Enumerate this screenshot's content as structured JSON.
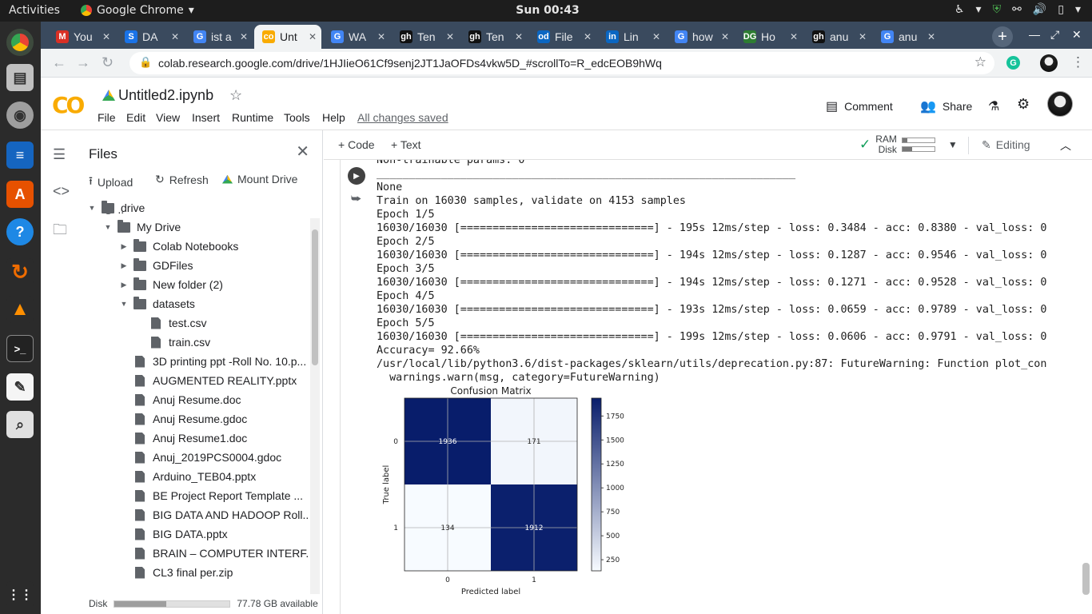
{
  "topbar": {
    "activities": "Activities",
    "app_name": "Google Chrome",
    "clock": "Sun 00:43"
  },
  "dock": {
    "icons": [
      "chrome-icon",
      "files-cabinet-icon",
      "disks-icon",
      "document-viewer-icon",
      "software-store-icon",
      "help-icon",
      "sync-icon",
      "vlc-icon",
      "terminal-icon",
      "text-editor-icon",
      "screenshot-icon",
      "app-grid-icon"
    ]
  },
  "tabs": [
    {
      "label": "You",
      "favicon": "M",
      "color": "#d93025"
    },
    {
      "label": "DA",
      "favicon": "S",
      "color": "#1a73e8"
    },
    {
      "label": "ist a",
      "favicon": "G",
      "color": "#4285f4"
    },
    {
      "label": "Unt",
      "favicon": "co",
      "color": "#f9ab00"
    },
    {
      "label": "WA",
      "favicon": "G",
      "color": "#4285f4"
    },
    {
      "label": "Ten",
      "favicon": "gh",
      "color": "#111111"
    },
    {
      "label": "Ten",
      "favicon": "gh",
      "color": "#111111"
    },
    {
      "label": "File",
      "favicon": "od",
      "color": "#0a66c2"
    },
    {
      "label": "Lin",
      "favicon": "in",
      "color": "#0a66c2"
    },
    {
      "label": "how",
      "favicon": "G",
      "color": "#4285f4"
    },
    {
      "label": "Ho",
      "favicon": "DG",
      "color": "#2e7d32"
    },
    {
      "label": "anu",
      "favicon": "gh",
      "color": "#111111"
    },
    {
      "label": "anu",
      "favicon": "G",
      "color": "#4285f4"
    }
  ],
  "address": {
    "url": "colab.research.google.com/drive/1HJIieO61Cf9senj2JT1JaOFDs4vkw5D_#scrollTo=R_edcEOB9hWq"
  },
  "colab": {
    "logo": "CO",
    "title": "Untitled2.ipynb",
    "menus": [
      "File",
      "Edit",
      "View",
      "Insert",
      "Runtime",
      "Tools",
      "Help"
    ],
    "saved_status": "All changes saved",
    "comment": "Comment",
    "share": "Share"
  },
  "files_panel": {
    "title": "Files",
    "upload": "Upload",
    "refresh": "Refresh",
    "mount": "Mount Drive",
    "up_dir": "..",
    "tree": [
      {
        "label": "drive",
        "type": "folder",
        "depth": 0,
        "caret": "▼"
      },
      {
        "label": "My Drive",
        "type": "folder",
        "depth": 1,
        "caret": "▼"
      },
      {
        "label": "Colab Notebooks",
        "type": "folder",
        "depth": 2,
        "caret": "▶"
      },
      {
        "label": "GDFiles",
        "type": "folder",
        "depth": 2,
        "caret": "▶"
      },
      {
        "label": "New folder (2)",
        "type": "folder",
        "depth": 2,
        "caret": "▶"
      },
      {
        "label": "datasets",
        "type": "folder",
        "depth": 2,
        "caret": "▼"
      },
      {
        "label": "test.csv",
        "type": "file",
        "depth": 3,
        "caret": ""
      },
      {
        "label": "train.csv",
        "type": "file",
        "depth": 3,
        "caret": ""
      },
      {
        "label": "3D printing ppt -Roll No. 10.p...",
        "type": "file",
        "depth": 2,
        "caret": ""
      },
      {
        "label": "AUGMENTED REALITY.pptx",
        "type": "file",
        "depth": 2,
        "caret": ""
      },
      {
        "label": "Anuj Resume.doc",
        "type": "file",
        "depth": 2,
        "caret": ""
      },
      {
        "label": "Anuj Resume.gdoc",
        "type": "file",
        "depth": 2,
        "caret": ""
      },
      {
        "label": "Anuj Resume1.doc",
        "type": "file",
        "depth": 2,
        "caret": ""
      },
      {
        "label": "Anuj_2019PCS0004.gdoc",
        "type": "file",
        "depth": 2,
        "caret": ""
      },
      {
        "label": "Arduino_TEB04.pptx",
        "type": "file",
        "depth": 2,
        "caret": ""
      },
      {
        "label": "BE Project Report Template ...",
        "type": "file",
        "depth": 2,
        "caret": ""
      },
      {
        "label": "BIG DATA AND HADOOP Roll...",
        "type": "file",
        "depth": 2,
        "caret": ""
      },
      {
        "label": "BIG DATA.pptx",
        "type": "file",
        "depth": 2,
        "caret": ""
      },
      {
        "label": "BRAIN – COMPUTER INTERF...",
        "type": "file",
        "depth": 2,
        "caret": ""
      },
      {
        "label": "CL3 final per.zip",
        "type": "file",
        "depth": 2,
        "caret": ""
      }
    ],
    "disk_label": "Disk",
    "disk_used_fraction": 0.45,
    "disk_available": "77.78 GB available"
  },
  "notebook_toolbar": {
    "code": "Code",
    "text": "Text",
    "ram": "RAM",
    "disk": "Disk",
    "ram_fraction": 0.15,
    "disk_fraction": 0.3,
    "editing": "Editing"
  },
  "output_lines": [
    "Non-trainable params: 0",
    "_________________________________________________________________",
    "None",
    "Train on 16030 samples, validate on 4153 samples",
    "Epoch 1/5",
    "16030/16030 [==============================] - 195s 12ms/step - loss: 0.3484 - acc: 0.8380 - val_loss: 0",
    "Epoch 2/5",
    "16030/16030 [==============================] - 194s 12ms/step - loss: 0.1287 - acc: 0.9546 - val_loss: 0",
    "Epoch 3/5",
    "16030/16030 [==============================] - 194s 12ms/step - loss: 0.1271 - acc: 0.9528 - val_loss: 0",
    "Epoch 4/5",
    "16030/16030 [==============================] - 193s 12ms/step - loss: 0.0659 - acc: 0.9789 - val_loss: 0",
    "Epoch 5/5",
    "16030/16030 [==============================] - 199s 12ms/step - loss: 0.0606 - acc: 0.9791 - val_loss: 0",
    "Accuracy= 92.66%",
    "/usr/local/lib/python3.6/dist-packages/sklearn/utils/deprecation.py:87: FutureWarning: Function plot_con",
    "  warnings.warn(msg, category=FutureWarning)"
  ],
  "chart_data": {
    "type": "heatmap",
    "title": "Confusion Matrix",
    "xlabel": "Predicted label",
    "ylabel": "True label",
    "x_ticks": [
      "0",
      "1"
    ],
    "y_ticks": [
      "0",
      "1"
    ],
    "matrix": [
      [
        1936,
        171
      ],
      [
        134,
        1912
      ]
    ],
    "colorbar_ticks": [
      250,
      500,
      750,
      1000,
      1250,
      1500,
      1750
    ],
    "vmin": 134,
    "vmax": 1936,
    "colormap": "Blues",
    "grid": true
  }
}
